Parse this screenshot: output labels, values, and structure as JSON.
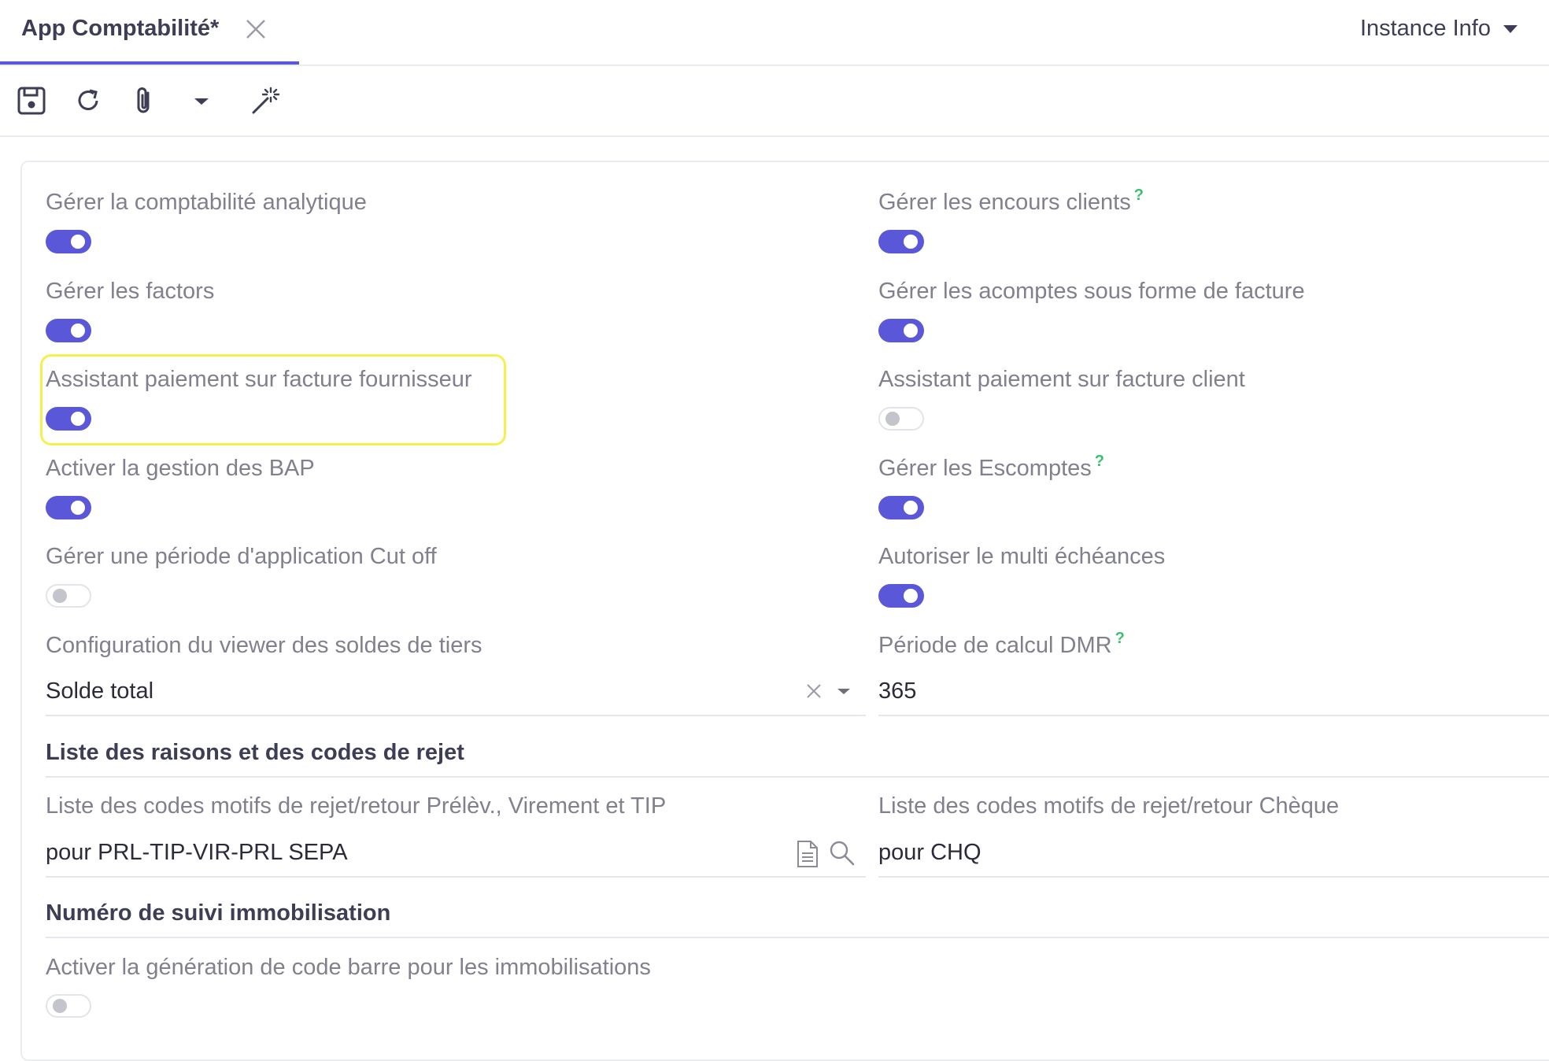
{
  "tab": {
    "title": "App Comptabilité*"
  },
  "header": {
    "instance_label": "Instance Info"
  },
  "toolbar": {
    "icons": [
      "save-icon",
      "refresh-icon",
      "attachment-icon",
      "dropdown-icon",
      "magic-wand-icon"
    ]
  },
  "colors": {
    "accent": "#5b57d9",
    "help": "#3bbf6e",
    "highlight": "#f5f04e"
  },
  "fields": {
    "analytique": {
      "label": "Gérer la comptabilité analytique",
      "on": true
    },
    "encours": {
      "label": "Gérer les encours clients",
      "help": "?",
      "on": true
    },
    "factors": {
      "label": "Gérer les factors",
      "on": true
    },
    "acomptes": {
      "label": "Gérer les acomptes sous forme de facture",
      "on": true
    },
    "assistant_fournisseur": {
      "label": "Assistant paiement sur facture fournisseur",
      "on": true
    },
    "assistant_client": {
      "label": "Assistant paiement sur facture client",
      "on": false
    },
    "bap": {
      "label": "Activer la gestion des BAP",
      "on": true
    },
    "escomptes": {
      "label": "Gérer les Escomptes",
      "help": "?",
      "on": true
    },
    "cutoff": {
      "label": "Gérer une période d'application Cut off",
      "on": false
    },
    "multi_echeances": {
      "label": "Autoriser le multi échéances",
      "on": true
    },
    "viewer_soldes": {
      "label": "Configuration du viewer des soldes de tiers",
      "value": "Solde total"
    },
    "periode_dmr": {
      "label": "Période de calcul DMR",
      "help": "?",
      "value": "365"
    },
    "codes_prel": {
      "label": "Liste des codes motifs de rejet/retour Prélèv., Virement et TIP",
      "value": "pour PRL-TIP-VIR-PRL SEPA"
    },
    "codes_cheque": {
      "label": "Liste des codes motifs de rejet/retour Chèque",
      "value": "pour CHQ"
    },
    "code_barre": {
      "label": "Activer la génération de code barre pour les immobilisations",
      "on": false
    }
  },
  "sections": {
    "rejet": "Liste des raisons et des codes de rejet",
    "immobilisation": "Numéro de suivi immobilisation"
  }
}
